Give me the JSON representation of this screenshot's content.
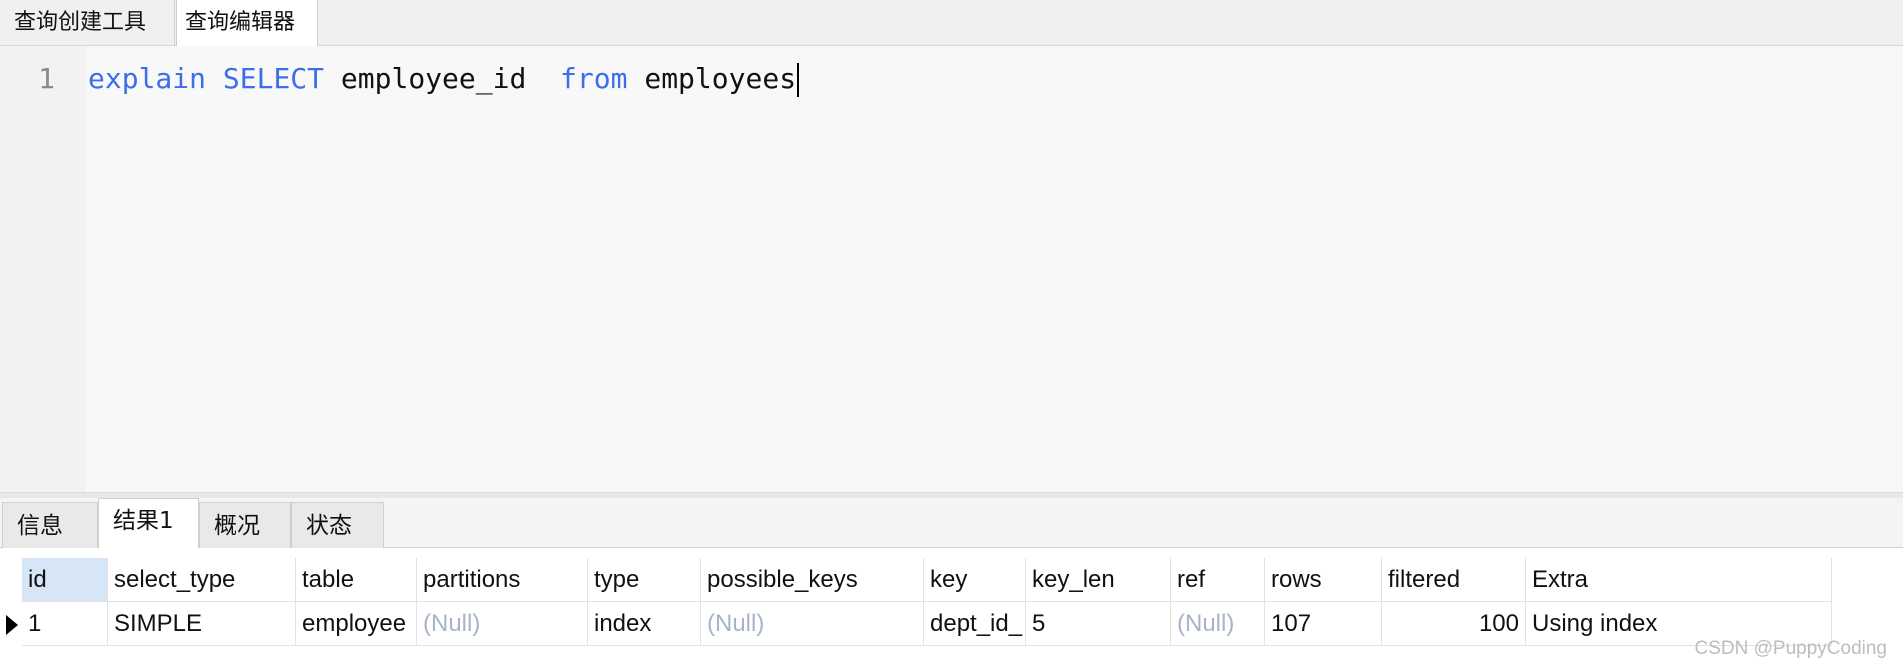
{
  "top_tabs": [
    "查询创建工具",
    "查询编辑器"
  ],
  "editor": {
    "line_number": "1",
    "tokens": {
      "kw1": "explain",
      "kw2": "SELECT",
      "col": "employee_id",
      "kw3": "from",
      "tbl": "employees"
    },
    "keyword_color": "#3b6ee8"
  },
  "result_tabs": [
    "信息",
    "结果1",
    "概况",
    "状态"
  ],
  "active_result_tab": "结果1",
  "grid": {
    "columns": [
      "id",
      "select_type",
      "table",
      "partitions",
      "type",
      "possible_keys",
      "key",
      "key_len",
      "ref",
      "rows",
      "filtered",
      "Extra"
    ],
    "row": [
      "1",
      "SIMPLE",
      "employee",
      "(Null)",
      "index",
      "(Null)",
      "dept_id_",
      "5",
      "(Null)",
      "107",
      "100",
      "Using index"
    ]
  },
  "watermark": "CSDN @PuppyCoding"
}
